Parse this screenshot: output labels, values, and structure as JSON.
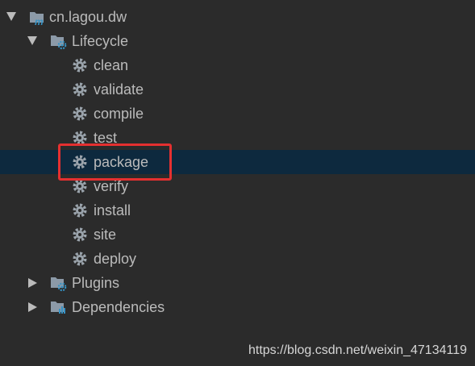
{
  "project": {
    "name": "cn.lagou.dw",
    "icon": "maven-module-icon"
  },
  "lifecycle": {
    "label": "Lifecycle",
    "icon": "folder-gear-icon",
    "goals": [
      {
        "label": "clean",
        "icon": "gear-icon"
      },
      {
        "label": "validate",
        "icon": "gear-icon"
      },
      {
        "label": "compile",
        "icon": "gear-icon"
      },
      {
        "label": "test",
        "icon": "gear-icon"
      },
      {
        "label": "package",
        "icon": "gear-icon"
      },
      {
        "label": "verify",
        "icon": "gear-icon"
      },
      {
        "label": "install",
        "icon": "gear-icon"
      },
      {
        "label": "site",
        "icon": "gear-icon"
      },
      {
        "label": "deploy",
        "icon": "gear-icon"
      }
    ],
    "selected_goal": "package"
  },
  "plugins": {
    "label": "Plugins",
    "icon": "folder-gear-icon"
  },
  "dependencies": {
    "label": "Dependencies",
    "icon": "folder-chart-icon"
  },
  "watermark": {
    "text": "https://blog.csdn.net/weixin_47134119"
  },
  "colors": {
    "background": "#2b2b2b",
    "selection": "#0d293e",
    "text": "#bbbbbb",
    "gear": "#9aa3ab",
    "folder": "#8c9aa8",
    "folder_badge": "#3592c4",
    "maven_badge": "#3592c4",
    "highlight_border": "#e53030"
  }
}
